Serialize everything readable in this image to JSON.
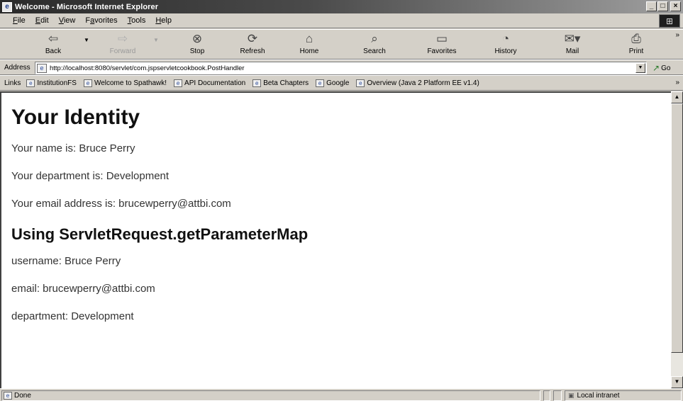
{
  "window": {
    "title": "Welcome - Microsoft Internet Explorer",
    "minimize": "_",
    "maximize": "□",
    "close": "×"
  },
  "menu": [
    {
      "pre": "",
      "key": "F",
      "post": "ile"
    },
    {
      "pre": "",
      "key": "E",
      "post": "dit"
    },
    {
      "pre": "",
      "key": "V",
      "post": "iew"
    },
    {
      "pre": "F",
      "key": "a",
      "post": "vorites"
    },
    {
      "pre": "",
      "key": "T",
      "post": "ools"
    },
    {
      "pre": "",
      "key": "H",
      "post": "elp"
    }
  ],
  "toolbar": {
    "back": "Back",
    "forward": "Forward",
    "stop": "Stop",
    "refresh": "Refresh",
    "home": "Home",
    "search": "Search",
    "favorites": "Favorites",
    "history": "History",
    "mail": "Mail",
    "print": "Print",
    "more": "»"
  },
  "address": {
    "label": "Address",
    "url": "http://localhost:8080/servlet/com.jspservletcookbook.PostHandler",
    "go": "Go"
  },
  "links": {
    "label": "Links",
    "items": [
      "InstitutionFS",
      "Welcome to Spathawk!",
      "API Documentation",
      "Beta Chapters",
      "Google",
      "Overview (Java 2 Platform EE v1.4)"
    ],
    "more": "»"
  },
  "page": {
    "heading": "Your Identity",
    "lines": [
      "Your name is: Bruce Perry",
      "Your department is: Development",
      "Your email address is: brucewperry@attbi.com"
    ],
    "subheading": "Using ServletRequest.getParameterMap",
    "params": [
      "username: Bruce Perry",
      "email: brucewperry@attbi.com",
      "department: Development"
    ]
  },
  "status": {
    "text": "Done",
    "zone": "Local intranet"
  }
}
